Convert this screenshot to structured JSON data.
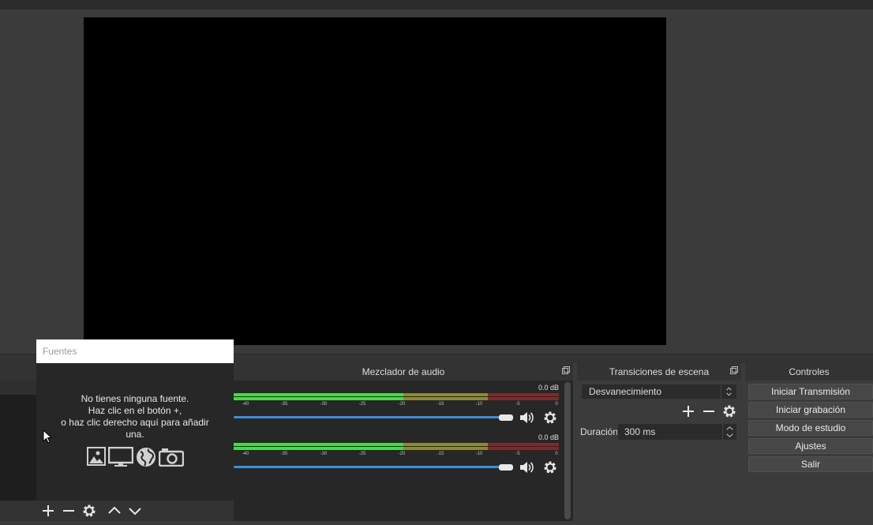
{
  "docks": {
    "mixer_title": "Mezclador de audio",
    "transitions_title": "Transiciones de escena",
    "controls_title": "Controles"
  },
  "fuentes": {
    "title": "Fuentes",
    "message_lines": [
      "No tienes ninguna fuente.",
      "Haz clic en el botón +,",
      "o haz clic derecho aquí para añadir",
      "una."
    ],
    "icons": [
      "image-source-icon",
      "display-capture-icon",
      "browser-source-icon",
      "camera-source-icon"
    ],
    "toolbar_icons": [
      "add-icon",
      "remove-icon",
      "gear-icon",
      "move-up-icon",
      "move-down-icon"
    ]
  },
  "mixer": {
    "channels": [
      {
        "db": "0.0 dB",
        "level": 0.92
      },
      {
        "db": "0.0 dB",
        "level": 0.92
      }
    ],
    "tick_labels": [
      "-40",
      "-35",
      "-30",
      "-25",
      "-20",
      "-15",
      "-10",
      "-5",
      "0"
    ]
  },
  "transitions": {
    "selected": "Desvanecimiento",
    "duration_label": "Duración",
    "duration_value": "300 ms"
  },
  "controls": {
    "buttons": [
      "Iniciar Transmisión",
      "Iniciar grabación",
      "Modo de estudio",
      "Ajustes",
      "Salir"
    ]
  },
  "colors": {
    "meter_green": "#4cd64c",
    "meter_yellow": "#d8d840",
    "meter_red": "#d84040",
    "volume_blue": "#3d8de0"
  }
}
